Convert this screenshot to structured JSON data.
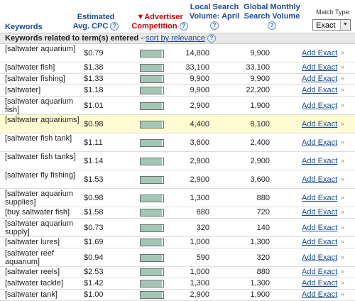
{
  "headers": {
    "keywords": "Keywords",
    "cpc_line1": "Estimated",
    "cpc_line2": "Avg. CPC",
    "comp_arrow": "▼",
    "comp_line1": "Advertiser",
    "comp_line2": "Competition",
    "lsv_line1": "Local Search",
    "lsv_line2": "Volume: April",
    "gms_line1": "Global Monthly",
    "gms_line2": "Search Volume",
    "help": "?"
  },
  "match_type": {
    "label": "Match Type:",
    "selected": "Exact",
    "arrow": "▼"
  },
  "section": {
    "text": "Keywords related to term(s) entered",
    "separator": " - ",
    "sort_link": "sort by relevance"
  },
  "rows": [
    {
      "kw": "[saltwater aquarium]",
      "cpc": "$0.79",
      "comp": 0.93,
      "lsv": "14,800",
      "gms": "9,900",
      "action": "Add Exact",
      "chev": "»",
      "lines": 2,
      "highlight": false
    },
    {
      "kw": "[saltwater fish]",
      "cpc": "$1.38",
      "comp": 0.93,
      "lsv": "33,100",
      "gms": "33,100",
      "action": "Add Exact",
      "chev": "»",
      "lines": 1,
      "highlight": false
    },
    {
      "kw": "[saltwater fishing]",
      "cpc": "$1.33",
      "comp": 0.93,
      "lsv": "9,900",
      "gms": "9,900",
      "action": "Add Exact",
      "chev": "»",
      "lines": 1,
      "highlight": false
    },
    {
      "kw": "[saltwater]",
      "cpc": "$1.18",
      "comp": 0.93,
      "lsv": "9,900",
      "gms": "22,200",
      "action": "Add Exact",
      "chev": "»",
      "lines": 1,
      "highlight": false
    },
    {
      "kw": "[saltwater aquarium fish]",
      "cpc": "$1.01",
      "comp": 0.93,
      "lsv": "2,900",
      "gms": "1,900",
      "action": "Add Exact",
      "chev": "»",
      "lines": 2,
      "highlight": false
    },
    {
      "kw": "[saltwater aquariums]",
      "cpc": "$0.98",
      "comp": 0.93,
      "lsv": "4,400",
      "gms": "8,100",
      "action": "Add Exact",
      "chev": "»",
      "lines": 2,
      "highlight": true
    },
    {
      "kw": "[saltwater fish tank]",
      "cpc": "$1.11",
      "comp": 0.93,
      "lsv": "3,600",
      "gms": "2,400",
      "action": "Add Exact",
      "chev": "»",
      "lines": 2,
      "highlight": false
    },
    {
      "kw": "[saltwater fish tanks]",
      "cpc": "$1.14",
      "comp": 0.93,
      "lsv": "2,900",
      "gms": "2,900",
      "action": "Add Exact",
      "chev": "»",
      "lines": 2,
      "highlight": false
    },
    {
      "kw": "[saltwater fly fishing]",
      "cpc": "$1.53",
      "comp": 0.93,
      "lsv": "2,900",
      "gms": "3,600",
      "action": "Add Exact",
      "chev": "»",
      "lines": 2,
      "highlight": false
    },
    {
      "kw": "[saltwater aquarium supplies]",
      "cpc": "$0.98",
      "comp": 0.93,
      "lsv": "1,300",
      "gms": "880",
      "action": "Add Exact",
      "chev": "»",
      "lines": 2,
      "highlight": false
    },
    {
      "kw": "[buy saltwater fish]",
      "cpc": "$1.58",
      "comp": 0.93,
      "lsv": "880",
      "gms": "720",
      "action": "Add Exact",
      "chev": "»",
      "lines": 1,
      "highlight": false
    },
    {
      "kw": "[saltwater aquarium supply]",
      "cpc": "$0.73",
      "comp": 0.93,
      "lsv": "320",
      "gms": "140",
      "action": "Add Exact",
      "chev": "»",
      "lines": 2,
      "highlight": false
    },
    {
      "kw": "[saltwater lures]",
      "cpc": "$1.69",
      "comp": 0.93,
      "lsv": "1,000",
      "gms": "1,300",
      "action": "Add Exact",
      "chev": "»",
      "lines": 1,
      "highlight": false
    },
    {
      "kw": "[saltwater reef aquarium]",
      "cpc": "$0.94",
      "comp": 0.93,
      "lsv": "590",
      "gms": "320",
      "action": "Add Exact",
      "chev": "»",
      "lines": 2,
      "highlight": false
    },
    {
      "kw": "[saltwater reels]",
      "cpc": "$2.53",
      "comp": 0.93,
      "lsv": "1,000",
      "gms": "880",
      "action": "Add Exact",
      "chev": "»",
      "lines": 1,
      "highlight": false
    },
    {
      "kw": "[saltwater tackle]",
      "cpc": "$1.42",
      "comp": 0.93,
      "lsv": "1,300",
      "gms": "1,300",
      "action": "Add Exact",
      "chev": "»",
      "lines": 1,
      "highlight": false
    },
    {
      "kw": "[saltwater tank]",
      "cpc": "$1.00",
      "comp": 0.93,
      "lsv": "2,900",
      "gms": "1,900",
      "action": "Add Exact",
      "chev": "»",
      "lines": 1,
      "highlight": false
    }
  ],
  "colors": {
    "link": "#1a4b96",
    "header_red": "#cc0000",
    "bar_fill": "#a3c7b5",
    "highlight_row": "#fffbd2"
  }
}
